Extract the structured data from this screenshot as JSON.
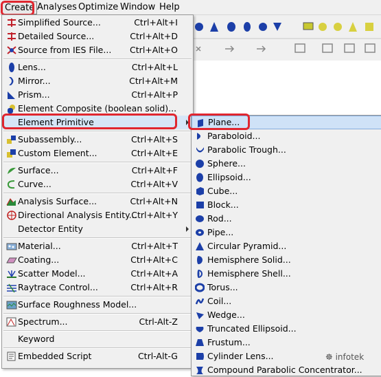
{
  "menubar": {
    "items": [
      "Create",
      "Analyses",
      "Optimize",
      "Window",
      "Help"
    ]
  },
  "create_menu": {
    "items": [
      {
        "label": "Simplified Source...",
        "shortcut": "Ctrl+Alt+I",
        "icon": "simplified-source-icon"
      },
      {
        "label": "Detailed Source...",
        "shortcut": "Ctrl+Alt+D",
        "icon": "detailed-source-icon"
      },
      {
        "label": "Source from IES File...",
        "shortcut": "Ctrl+Alt+O",
        "icon": "ies-source-icon"
      },
      {
        "label": "Lens...",
        "shortcut": "Ctrl+Alt+L",
        "icon": "lens-icon"
      },
      {
        "label": "Mirror...",
        "shortcut": "Ctrl+Alt+M",
        "icon": "mirror-icon"
      },
      {
        "label": "Prism...",
        "shortcut": "Ctrl+Alt+P",
        "icon": "prism-icon"
      },
      {
        "label": "Element Composite (boolean solid)...",
        "shortcut": "",
        "icon": "composite-icon"
      },
      {
        "label": "Element Primitive",
        "shortcut": "",
        "icon": ""
      },
      {
        "label": "Subassembly...",
        "shortcut": "Ctrl+Alt+S",
        "icon": "subassembly-icon"
      },
      {
        "label": "Custom Element...",
        "shortcut": "Ctrl+Alt+E",
        "icon": "custom-element-icon"
      },
      {
        "label": "Surface...",
        "shortcut": "Ctrl+Alt+F",
        "icon": "surface-icon"
      },
      {
        "label": "Curve...",
        "shortcut": "Ctrl+Alt+V",
        "icon": "curve-icon"
      },
      {
        "label": "Analysis Surface...",
        "shortcut": "Ctrl+Alt+N",
        "icon": "analysis-surface-icon"
      },
      {
        "label": "Directional Analysis Entity...",
        "shortcut": "Ctrl+Alt+Y",
        "icon": "directional-analysis-icon"
      },
      {
        "label": "Detector Entity",
        "shortcut": "",
        "icon": ""
      },
      {
        "label": "Material...",
        "shortcut": "Ctrl+Alt+T",
        "icon": "material-icon"
      },
      {
        "label": "Coating...",
        "shortcut": "Ctrl+Alt+C",
        "icon": "coating-icon"
      },
      {
        "label": "Scatter Model...",
        "shortcut": "Ctrl+Alt+A",
        "icon": "scatter-model-icon"
      },
      {
        "label": "Raytrace Control...",
        "shortcut": "Ctrl+Alt+R",
        "icon": "raytrace-control-icon"
      },
      {
        "label": "Surface Roughness Model...",
        "shortcut": "",
        "icon": "surface-roughness-icon"
      },
      {
        "label": "Spectrum...",
        "shortcut": "Ctrl-Alt-Z",
        "icon": "spectrum-icon"
      },
      {
        "label": "Keyword",
        "shortcut": "",
        "icon": ""
      },
      {
        "label": "Embedded Script",
        "shortcut": "Ctrl-Alt-G",
        "icon": "embedded-script-icon"
      }
    ]
  },
  "primitive_submenu": {
    "items": [
      "Plane...",
      "Paraboloid...",
      "Parabolic Trough...",
      "Sphere...",
      "Ellipsoid...",
      "Cube...",
      "Block...",
      "Rod...",
      "Pipe...",
      "Circular Pyramid...",
      "Hemisphere Solid...",
      "Hemisphere Shell...",
      "Torus...",
      "Coil...",
      "Wedge...",
      "Truncated Ellipsoid...",
      "Frustum...",
      "Cylinder Lens...",
      "Compound Parabolic Concentrator..."
    ]
  },
  "watermark": "infotek",
  "colors": {
    "highlight_oval": "#e0262f",
    "icon_blue": "#1c3fa8",
    "selection_bg": "#cfe2f7"
  }
}
